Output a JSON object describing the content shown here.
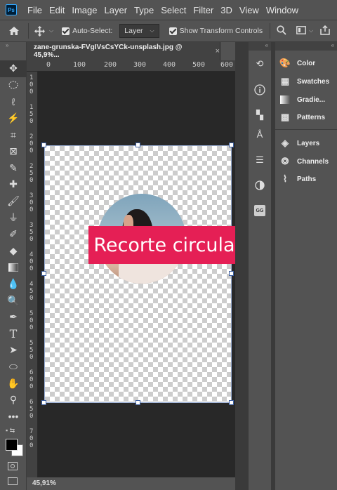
{
  "app": {
    "logo": "Ps"
  },
  "menu": [
    "File",
    "Edit",
    "Image",
    "Layer",
    "Type",
    "Select",
    "Filter",
    "3D",
    "View",
    "Window"
  ],
  "options": {
    "home_icon": "home-icon",
    "move_icon": "move-icon",
    "auto_select_label": "Auto-Select:",
    "auto_select_value": "Layer",
    "show_transform_label": "Show Transform Controls"
  },
  "doc": {
    "tab_title": "zane-grunska-FVgIVsCsYCk-unsplash.jpg @ 45,9%...",
    "close": "×",
    "zoom": "45,91%"
  },
  "ruler": {
    "top": [
      "0",
      "100",
      "200",
      "300",
      "400",
      "500",
      "600"
    ],
    "left": [
      "1\n0\n0",
      "1\n5\n0",
      "2\n0\n0",
      "2\n5\n0",
      "3\n0\n0",
      "3\n5\n0",
      "4\n0\n0",
      "4\n5\n0",
      "5\n0\n0",
      "5\n5\n0",
      "6\n0\n0",
      "6\n5\n0",
      "7\n0\n0"
    ]
  },
  "canvas": {
    "overlay_text": "Recorte circular",
    "banner_color": "#e51f55"
  },
  "tools": [
    "move-icon",
    "marquee-icon",
    "lasso-icon",
    "magic-wand-icon",
    "crop-icon",
    "frame-icon",
    "eyedropper-icon",
    "healing-icon",
    "brush-icon",
    "stamp-icon",
    "history-brush-icon",
    "eraser-icon",
    "gradient-icon",
    "blur-icon",
    "dodge-icon",
    "pen-icon",
    "type-icon",
    "path-select-icon",
    "shape-icon",
    "hand-icon",
    "zoom-icon",
    "more-icon"
  ],
  "panels": {
    "icon_column": [
      "history-icon",
      "info-icon",
      "properties-icon",
      "character-icon",
      "adjust-icon",
      "libraries-icon",
      "gg-icon"
    ],
    "items": [
      {
        "icon": "color-icon",
        "label": "Color"
      },
      {
        "icon": "swatches-icon",
        "label": "Swatches"
      },
      {
        "icon": "gradients-icon",
        "label": "Gradie..."
      },
      {
        "icon": "patterns-icon",
        "label": "Patterns"
      },
      {
        "icon": "layers-icon",
        "label": "Layers"
      },
      {
        "icon": "channels-icon",
        "label": "Channels"
      },
      {
        "icon": "paths-icon",
        "label": "Paths"
      }
    ],
    "gg_label": "GG"
  }
}
